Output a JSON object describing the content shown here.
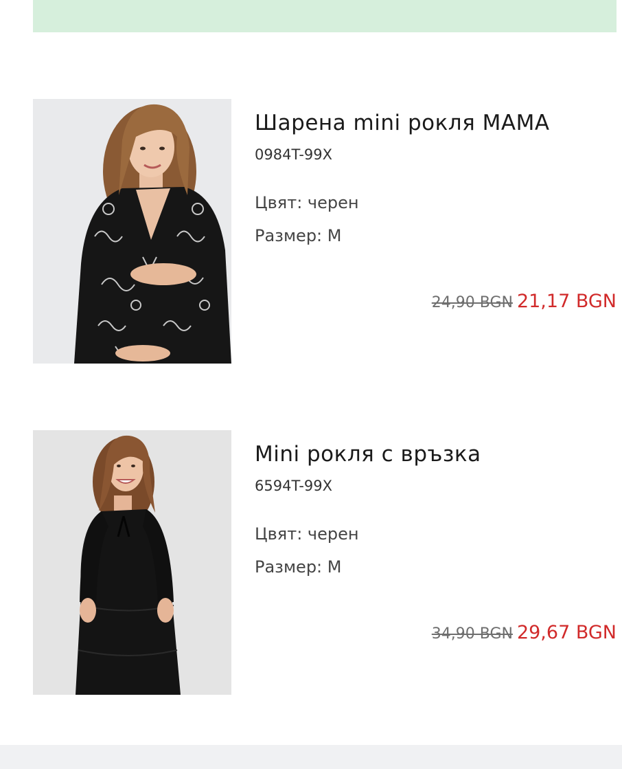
{
  "colors": {
    "banner": "#d6efdc",
    "sale_price": "#d12a2a",
    "old_price": "#6e6e6e",
    "footer": "#f0f1f3"
  },
  "products": [
    {
      "title": "Шарена mini рокля MAMA",
      "sku": "0984T-99X",
      "color_text": "Цвят: черен",
      "size_text": "Размер: M",
      "old_price": "24,90 BGN",
      "new_price": "21,17 BGN",
      "image_alt": "pregnant-model-in-black-floral-print-dress"
    },
    {
      "title": "Mini рокля с връзка",
      "sku": "6594T-99X",
      "color_text": "Цвят: черен",
      "size_text": "Размер: M",
      "old_price": "34,90 BGN",
      "new_price": "29,67 BGN",
      "image_alt": "model-in-black-tiered-mini-dress"
    }
  ]
}
